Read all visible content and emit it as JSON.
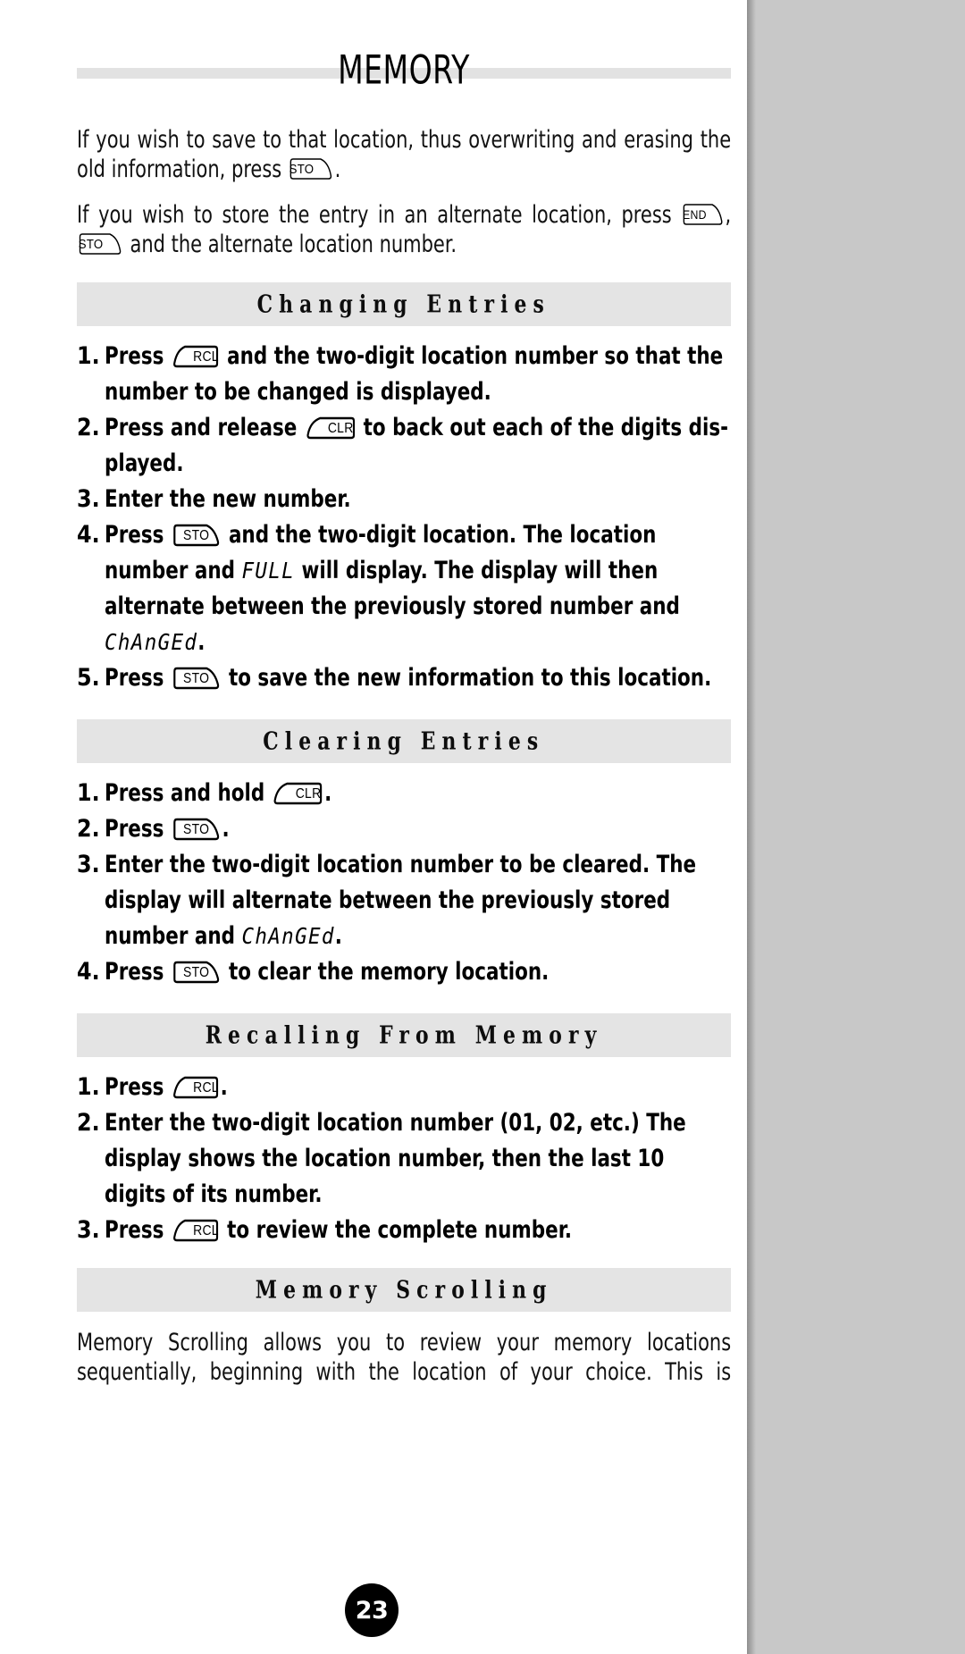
{
  "document": {
    "title": "MEMORY",
    "page_number": "23"
  },
  "intro": {
    "paragraph_1_before": "If you wish to save to that location, thus overwriting and erasing the old information, press ",
    "paragraph_1_key": "STO",
    "paragraph_1_after": ".",
    "paragraph_2_a": "If you wish to store the entry in an alternate location, press ",
    "paragraph_2_key1": "END",
    "paragraph_2_b": ", ",
    "paragraph_2_key2": "STO",
    "paragraph_2_c": " and the alternate location number."
  },
  "sections": [
    {
      "heading": "Changing Entries",
      "steps": [
        {
          "number": "1.",
          "parts": [
            {
              "type": "text",
              "value": "Press "
            },
            {
              "type": "key",
              "value": "RCL",
              "shape": "left"
            },
            {
              "type": "text",
              "value": " and the two-digit location number so that the number to be changed is displayed."
            }
          ]
        },
        {
          "number": "2.",
          "parts": [
            {
              "type": "text",
              "value": "Press and release "
            },
            {
              "type": "key",
              "value": "CLR",
              "shape": "left"
            },
            {
              "type": "text",
              "value": " to back out each of the digits dis­ played."
            }
          ]
        },
        {
          "number": "3.",
          "parts": [
            {
              "type": "text",
              "value": "Enter the new number."
            }
          ]
        },
        {
          "number": "4.",
          "parts": [
            {
              "type": "text",
              "value": "Press "
            },
            {
              "type": "key",
              "value": "STO",
              "shape": "right"
            },
            {
              "type": "text",
              "value": " and the two-digit location. The location number and "
            },
            {
              "type": "lcd",
              "value": "FULL"
            },
            {
              "type": "text",
              "value": " will display. The display will then alternate between the previously stored number and "
            },
            {
              "type": "lcd",
              "value": "ChAnGEd"
            },
            {
              "type": "text",
              "value": "."
            }
          ]
        },
        {
          "number": "5.",
          "parts": [
            {
              "type": "text",
              "value": "Press "
            },
            {
              "type": "key",
              "value": "STO",
              "shape": "right"
            },
            {
              "type": "text",
              "value": " to save the new information to this location."
            }
          ]
        }
      ]
    },
    {
      "heading": "Clearing Entries",
      "steps": [
        {
          "number": "1.",
          "parts": [
            {
              "type": "text",
              "value": "Press and hold "
            },
            {
              "type": "key",
              "value": "CLR",
              "shape": "left"
            },
            {
              "type": "text",
              "value": "."
            }
          ]
        },
        {
          "number": "2.",
          "parts": [
            {
              "type": "text",
              "value": "Press "
            },
            {
              "type": "key",
              "value": "STO",
              "shape": "right"
            },
            {
              "type": "text",
              "value": "."
            }
          ]
        },
        {
          "number": "3.",
          "parts": [
            {
              "type": "text",
              "value": "Enter the two-digit location number to be cleared. The display will alternate between the previously stored number and "
            },
            {
              "type": "lcd",
              "value": "ChAnGEd"
            },
            {
              "type": "text",
              "value": "."
            }
          ]
        },
        {
          "number": "4.",
          "parts": [
            {
              "type": "text",
              "value": "Press "
            },
            {
              "type": "key",
              "value": "STO",
              "shape": "right"
            },
            {
              "type": "text",
              "value": " to clear the memory location."
            }
          ]
        }
      ]
    },
    {
      "heading": "Recalling From Memory",
      "steps": [
        {
          "number": "1.",
          "parts": [
            {
              "type": "text",
              "value": "Press "
            },
            {
              "type": "key",
              "value": "RCL",
              "shape": "left"
            },
            {
              "type": "text",
              "value": "."
            }
          ]
        },
        {
          "number": "2.",
          "parts": [
            {
              "type": "text",
              "value": "Enter the two-digit location number (01, 02, etc.) The display shows the location number, then the last 10 digits of its number."
            }
          ]
        },
        {
          "number": "3.",
          "parts": [
            {
              "type": "text",
              "value": "Press "
            },
            {
              "type": "key",
              "value": "RCL",
              "shape": "left"
            },
            {
              "type": "text",
              "value": " to review the complete number."
            }
          ]
        }
      ]
    },
    {
      "heading": "Memory Scrolling",
      "steps": [],
      "paragraph": "Memory Scrolling allows you to review your memory locations sequentially, beginning with the location of your choice. This is"
    }
  ],
  "colors": {
    "band_gray": "#e4e4e4",
    "title_bar_gray": "#e2e2e2",
    "page_white": "#ffffff",
    "outside_gray": "#c8c8c8",
    "text_black": "#000000"
  }
}
